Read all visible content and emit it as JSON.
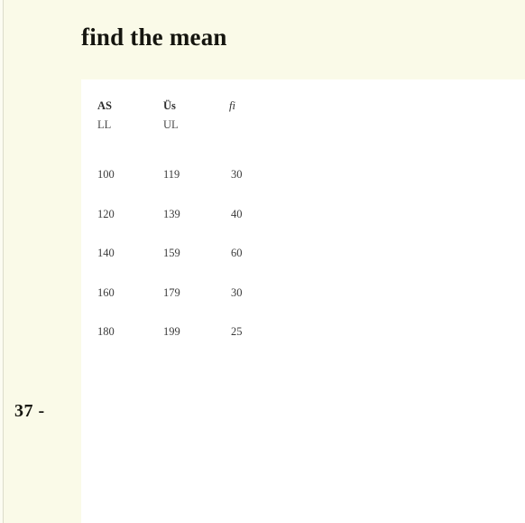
{
  "document": {
    "title": "find the mean",
    "page_marker": "37 -"
  },
  "colors": {
    "background_cream": "#FAFAE8",
    "panel_white": "#FFFFFF",
    "text_dark": "#15150F",
    "text_body": "#3B3B3B"
  },
  "table": {
    "headers": {
      "col1_abbr": "AS",
      "col1_sub": "LL",
      "col2_abbr": "Üs",
      "col2_sub": "UL",
      "col3_abbr": "fi"
    },
    "rows": [
      {
        "lower_limit": "100",
        "upper_limit": "119",
        "frequency": "30"
      },
      {
        "lower_limit": "120",
        "upper_limit": "139",
        "frequency": "40"
      },
      {
        "lower_limit": "140",
        "upper_limit": "159",
        "frequency": "60"
      },
      {
        "lower_limit": "160",
        "upper_limit": "179",
        "frequency": "30"
      },
      {
        "lower_limit": "180",
        "upper_limit": "199",
        "frequency": "25"
      }
    ]
  }
}
